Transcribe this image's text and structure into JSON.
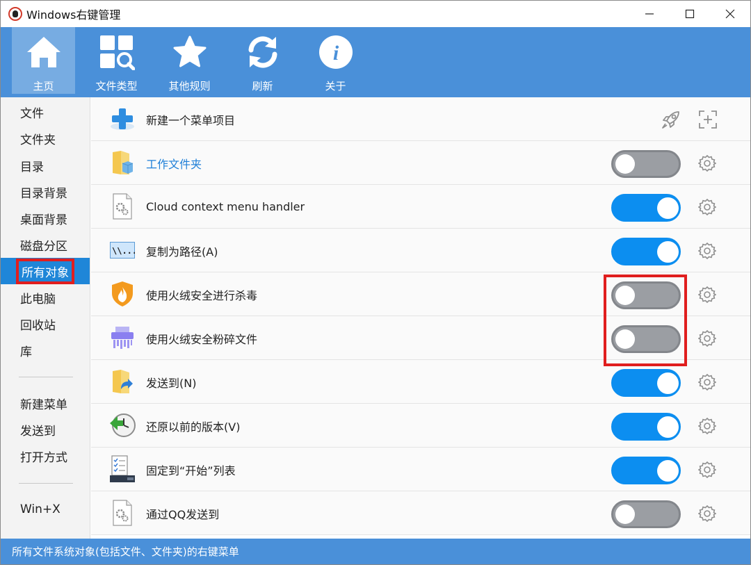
{
  "window": {
    "title": "Windows右键管理"
  },
  "toolbar": {
    "items": [
      {
        "label": "主页",
        "icon": "home-icon",
        "active": true
      },
      {
        "label": "文件类型",
        "icon": "file-types-search-icon",
        "active": false
      },
      {
        "label": "其他规则",
        "icon": "star-icon",
        "active": false
      },
      {
        "label": "刷新",
        "icon": "refresh-icon",
        "active": false
      },
      {
        "label": "关于",
        "icon": "info-icon",
        "active": false
      }
    ]
  },
  "sidebar": {
    "items": [
      {
        "label": "文件"
      },
      {
        "label": "文件夹"
      },
      {
        "label": "目录"
      },
      {
        "label": "目录背景"
      },
      {
        "label": "桌面背景"
      },
      {
        "label": "磁盘分区"
      },
      {
        "label": "所有对象",
        "active": true
      },
      {
        "label": "此电脑"
      },
      {
        "label": "回收站"
      },
      {
        "label": "库"
      }
    ],
    "group2": [
      {
        "label": "新建菜单"
      },
      {
        "label": "发送到"
      },
      {
        "label": "打开方式"
      }
    ],
    "group3": [
      {
        "label": "Win+X"
      }
    ]
  },
  "list": {
    "new_item_label": "新建一个菜单项目",
    "rows": [
      {
        "label": "工作文件夹",
        "enabled": false,
        "icon": "work-folder-icon",
        "link": true
      },
      {
        "label": "Cloud context menu handler",
        "enabled": true,
        "icon": "settings-file-icon"
      },
      {
        "label": "复制为路径(A)",
        "enabled": true,
        "icon": "copy-path-icon"
      },
      {
        "label": "使用火绒安全进行杀毒",
        "enabled": false,
        "icon": "huorong-shield-icon"
      },
      {
        "label": "使用火绒安全粉碎文件",
        "enabled": false,
        "icon": "shredder-icon"
      },
      {
        "label": "发送到(N)",
        "enabled": true,
        "icon": "send-to-folder-icon"
      },
      {
        "label": "还原以前的版本(V)",
        "enabled": true,
        "icon": "restore-clock-icon"
      },
      {
        "label": "固定到“开始”列表",
        "enabled": true,
        "icon": "pin-start-icon"
      },
      {
        "label": "通过QQ发送到",
        "enabled": false,
        "icon": "settings-file-icon"
      }
    ]
  },
  "statusbar": {
    "text": "所有文件系统对象(包括文件、文件夹)的右键菜单"
  },
  "colors": {
    "accent": "#4a90d9",
    "toggle_on": "#0c8ef0",
    "toggle_off": "#9b9ea3",
    "highlight": "#e01e1e",
    "selected": "#1f86d8"
  }
}
